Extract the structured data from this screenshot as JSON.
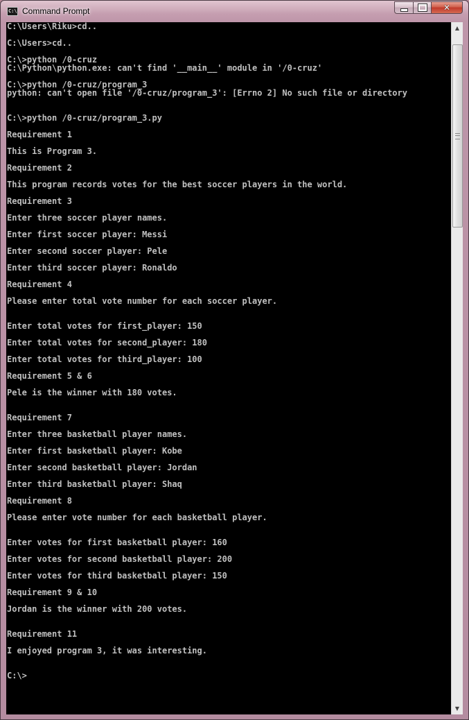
{
  "window": {
    "title": "Command Prompt",
    "icon": "terminal-icon",
    "controls": {
      "minimize": "minimize-icon",
      "maximize": "maximize-icon",
      "close": "close-icon"
    }
  },
  "console": {
    "lines": [
      "C:\\Users\\Riku>cd..",
      "",
      "C:\\Users>cd..",
      "",
      "C:\\>python /0-cruz",
      "C:\\Python\\python.exe: can't find '__main__' module in '/0-cruz'",
      "",
      "C:\\>python /0-cruz/program_3",
      "python: can't open file '/0-cruz/program_3': [Errno 2] No such file or directory",
      "",
      "",
      "C:\\>python /0-cruz/program_3.py",
      "",
      "Requirement 1",
      "",
      "This is Program 3.",
      "",
      "Requirement 2",
      "",
      "This program records votes for the best soccer players in the world.",
      "",
      "Requirement 3",
      "",
      "Enter three soccer player names.",
      "",
      "Enter first soccer player: Messi",
      "",
      "Enter second soccer player: Pele",
      "",
      "Enter third soccer player: Ronaldo",
      "",
      "Requirement 4",
      "",
      "Please enter total vote number for each soccer player.",
      "",
      "",
      "Enter total votes for first_player: 150",
      "",
      "Enter total votes for second_player: 180",
      "",
      "Enter total votes for third_player: 100",
      "",
      "Requirement 5 & 6",
      "",
      "Pele is the winner with 180 votes.",
      "",
      "",
      "Requirement 7",
      "",
      "Enter three basketball player names.",
      "",
      "Enter first basketball player: Kobe",
      "",
      "Enter second basketball player: Jordan",
      "",
      "Enter third basketball player: Shaq",
      "",
      "Requirement 8",
      "",
      "Please enter vote number for each basketball player.",
      "",
      "",
      "Enter votes for first basketball player: 160",
      "",
      "Enter votes for second basketball player: 200",
      "",
      "Enter votes for third basketball player: 150",
      "",
      "Requirement 9 & 10",
      "",
      "Jordan is the winner with 200 votes.",
      "",
      "",
      "Requirement 11",
      "",
      "I enjoyed program 3, it was interesting.",
      "",
      "",
      "C:\\>"
    ]
  },
  "scrollbar": {
    "up_icon": "scroll-up-arrow-icon",
    "down_icon": "scroll-down-arrow-icon"
  },
  "colors": {
    "console_bg": "#000000",
    "console_fg": "#c0c0c0",
    "close_button": "#c1392a"
  }
}
